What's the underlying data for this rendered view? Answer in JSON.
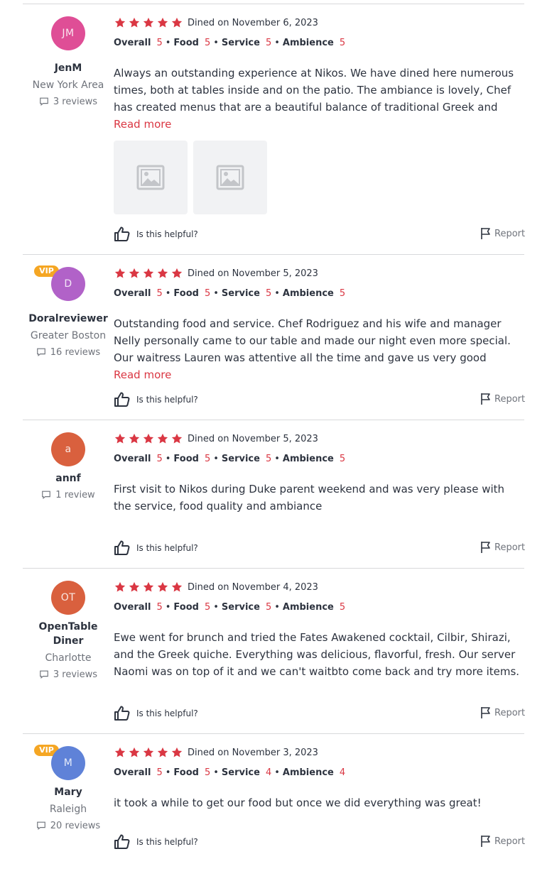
{
  "labels": {
    "dined_prefix": "Dined on",
    "overall": "Overall",
    "food": "Food",
    "service": "Service",
    "ambience": "Ambience",
    "separator": "•",
    "read_more": "Read more",
    "helpful": "Is this helpful?",
    "report": "Report",
    "vip": "VIP"
  },
  "colors": {
    "accent": "#da3743",
    "vip": "#f5a623"
  },
  "reviews": [
    {
      "initials": "JM",
      "avatar_color": "#df4e96",
      "vip": false,
      "name": "JenM",
      "location": "New York Area",
      "review_count": "3 reviews",
      "stars": 5,
      "dined_date": "Dined on November 6, 2023",
      "overall": "5",
      "food": "5",
      "service": "5",
      "ambience": "5",
      "text": "Always an outstanding experience at Nikos. We have dined here numerous times, both at tables inside and on the patio. The ambiance is lovely, Chef has created menus that are a beautiful balance of traditional Greek and creatively updated ...",
      "read_more": true,
      "photos": 2
    },
    {
      "initials": "D",
      "avatar_color": "#b162c8",
      "vip": true,
      "name": "Doralreviewer",
      "location": "Greater Boston",
      "review_count": "16 reviews",
      "stars": 5,
      "dined_date": "Dined on November 5, 2023",
      "overall": "5",
      "food": "5",
      "service": "5",
      "ambience": "5",
      "text": "Outstanding food and service. Chef Rodriguez and his wife and manager Nelly personally came to our table and made our night even more special. Our waitress Lauren was attentive all the time and gave us very good recommendations. We ...",
      "read_more": true,
      "photos": 0
    },
    {
      "initials": "a",
      "avatar_color": "#d9603e",
      "vip": false,
      "name": "annf",
      "location": "",
      "review_count": "1 review",
      "stars": 5,
      "dined_date": "Dined on November 5, 2023",
      "overall": "5",
      "food": "5",
      "service": "5",
      "ambience": "5",
      "text": "First visit to Nikos during Duke parent weekend and was very please with the service, food quality and ambiance",
      "read_more": false,
      "photos": 0
    },
    {
      "initials": "OT",
      "avatar_color": "#d9603e",
      "vip": false,
      "name": "OpenTable Diner",
      "location": "Charlotte",
      "review_count": "3 reviews",
      "stars": 5,
      "dined_date": "Dined on November 4, 2023",
      "overall": "5",
      "food": "5",
      "service": "5",
      "ambience": "5",
      "text": "Ewe went for brunch and tried the Fates Awakened cocktail, Cilbir, Shirazi, and the Greek quiche. Everything was delicious, flavorful, fresh. Our server Naomi was on top of it and we can't waitbto come back and try more items.",
      "read_more": false,
      "photos": 0
    },
    {
      "initials": "M",
      "avatar_color": "#5f82d8",
      "vip": true,
      "name": "Mary",
      "location": "Raleigh",
      "review_count": "20 reviews",
      "stars": 5,
      "dined_date": "Dined on November 3, 2023",
      "overall": "5",
      "food": "5",
      "service": "4",
      "ambience": "4",
      "text": "it took a while to get our food but once we did everything was great!",
      "read_more": false,
      "photos": 0
    }
  ]
}
